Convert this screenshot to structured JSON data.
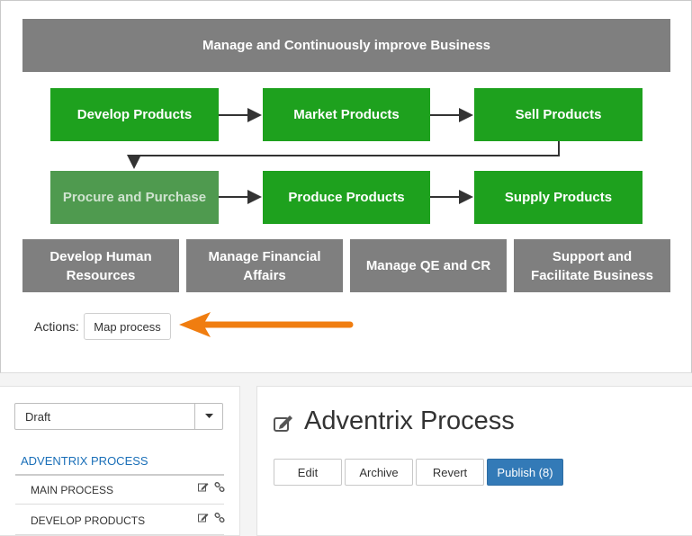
{
  "diagram": {
    "header": "Manage and Continuously improve Business",
    "row1": [
      "Develop Products",
      "Market Products",
      "Sell Products"
    ],
    "row2": [
      "Procure and Purchase",
      "Produce Products",
      "Supply Products"
    ],
    "row3": [
      "Develop Human Resources",
      "Manage Financial Affairs",
      "Manage QE and CR",
      "Support and Facilitate Business"
    ]
  },
  "actions": {
    "label": "Actions:",
    "map_button": "Map process"
  },
  "colors": {
    "gray_box": "#7f7f7f",
    "green_box": "#1ea11e",
    "faded_green_box": "#4f9a4f",
    "arrow_orange": "#f07d10",
    "link_blue": "#1a6fb8",
    "primary_button": "#337ab7"
  },
  "sidebar": {
    "status_select": "Draft",
    "root": "ADVENTRIX PROCESS",
    "items": [
      {
        "label": "MAIN PROCESS"
      },
      {
        "label": "DEVELOP PRODUCTS"
      }
    ]
  },
  "main": {
    "title": "Adventrix Process",
    "buttons": {
      "edit": "Edit",
      "archive": "Archive",
      "revert": "Revert",
      "publish": "Publish (8)"
    }
  }
}
